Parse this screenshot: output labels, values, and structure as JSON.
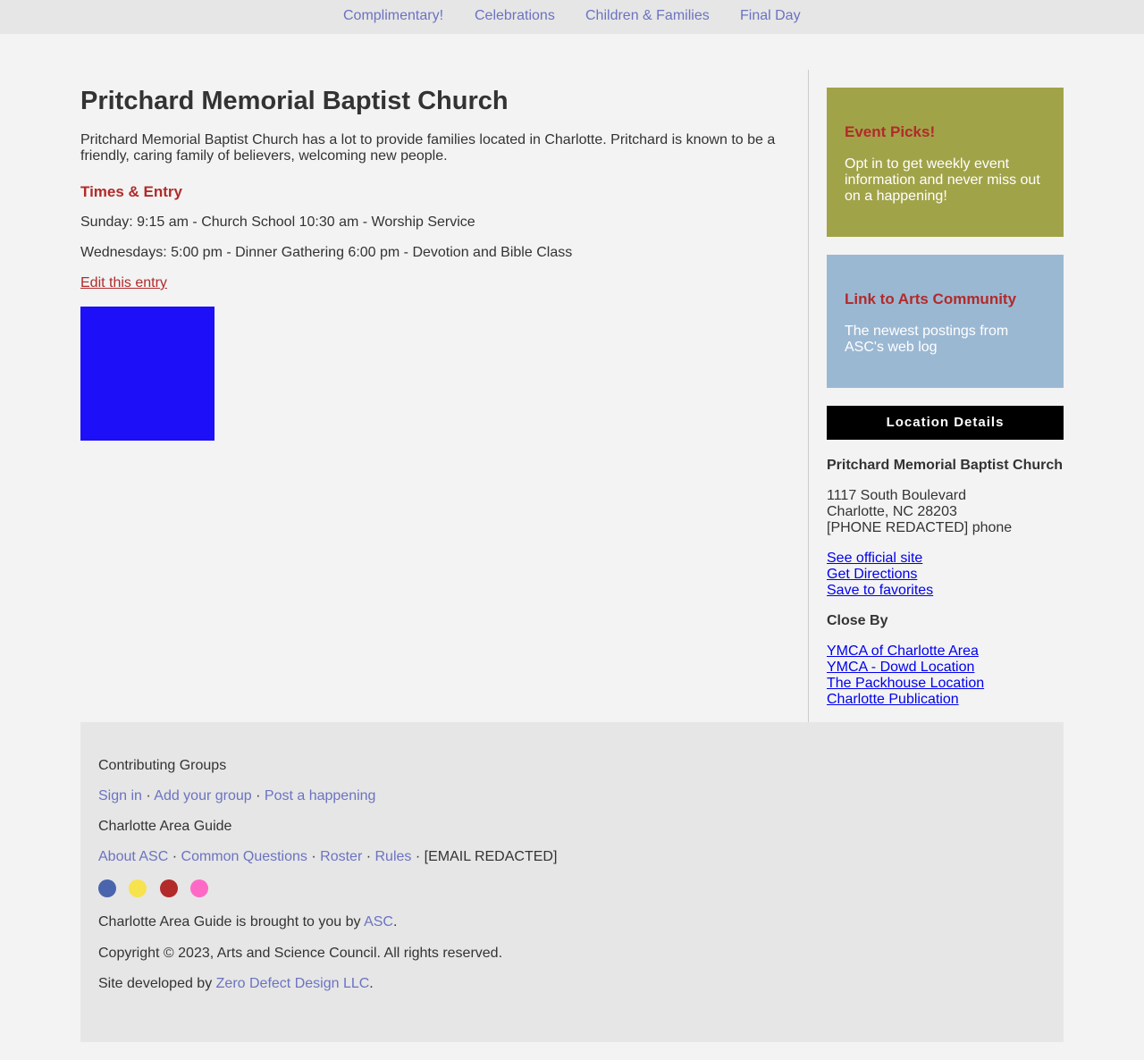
{
  "nav": {
    "items": [
      {
        "label": "Complimentary!"
      },
      {
        "label": "Celebrations"
      },
      {
        "label": "Children & Families"
      },
      {
        "label": "Final Day"
      }
    ]
  },
  "main": {
    "title": "Pritchard Memorial Baptist Church",
    "intro": "Pritchard Memorial Baptist Church has a lot to provide families located in Charlotte. Pritchard is known to be a friendly, caring family of believers, welcoming new people.",
    "times_heading": "Times & Entry",
    "sunday": "Sunday: 9:15 am - Church School 10:30 am - Worship Service",
    "wednesday": "Wednesdays: 5:00 pm - Dinner Gathering 6:00 pm - Devotion and Bible Class",
    "edit_link": "Edit this entry"
  },
  "sidebar": {
    "event_picks": {
      "heading": "Event Picks!",
      "text": "Opt in to get weekly event information and never miss out on a happening!"
    },
    "arts_community": {
      "heading": "Link to Arts Community",
      "text": "The newest postings from ASC's web log"
    },
    "location_details": {
      "heading": "Location Details",
      "name": "Pritchard Memorial Baptist Church",
      "address_line1": "1117 South Boulevard",
      "address_line2": "Charlotte, NC 28203",
      "phone": "[PHONE REDACTED] phone",
      "links": [
        "See official site",
        "Get Directions",
        "Save to favorites"
      ]
    },
    "close_by": {
      "heading": "Close By",
      "links": [
        "YMCA of Charlotte Area",
        "YMCA - Dowd Location",
        "The Packhouse Location",
        "Charlotte Publication"
      ]
    }
  },
  "footer": {
    "contributing_heading": "Contributing Groups",
    "contributing_links": [
      "Sign in",
      "Add your group",
      "Post a happening"
    ],
    "guide_heading": "Charlotte Area Guide",
    "guide_links": [
      "About ASC",
      "Common Questions",
      "Roster",
      "Rules"
    ],
    "email": "[EMAIL REDACTED]",
    "separator": "·",
    "social_colors": [
      "#4a65ad",
      "#f6e34e",
      "#b22a2a",
      "#ff69c6"
    ],
    "brought_prefix": "Charlotte Area Guide is brought to you by ",
    "brought_link": "ASC",
    "period": ".",
    "copyright": "Copyright © 2023, Arts and Science Council. All rights reserved.",
    "developed_prefix": "Site developed by ",
    "developed_link": "Zero Defect Design LLC"
  },
  "colors": {
    "accent_red": "#b22a2a",
    "link_purple": "#6b73c1",
    "event_box": "#a1a349",
    "arts_box": "#9bb8d3",
    "image_blue": "#1d0ff7"
  }
}
